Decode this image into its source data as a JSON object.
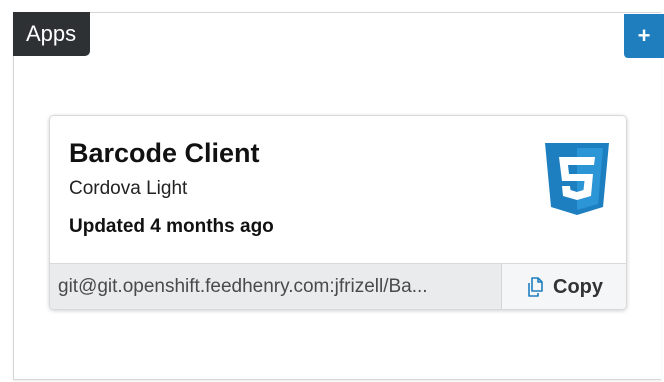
{
  "panel": {
    "title": "Apps",
    "add_button_label": "+"
  },
  "app_card": {
    "title": "Barcode Client",
    "subtitle": "Cordova Light",
    "updated": "Updated 4 months ago",
    "logo_icon": "html5-icon",
    "git_url": "git@git.openshift.feedhenry.com:jfrizell/Ba...",
    "copy_label": "Copy",
    "copy_icon": "copy-icon"
  },
  "colors": {
    "tab_background": "#2d3134",
    "accent_blue": "#1f7fbe",
    "html5_blue": "#1d7fc0",
    "footer_background": "#e9ebed"
  }
}
